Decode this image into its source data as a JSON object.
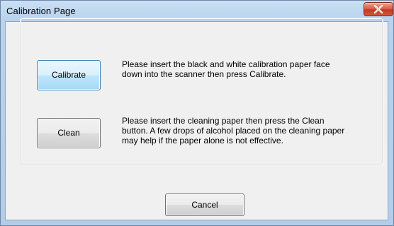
{
  "window": {
    "title": "Calibration Page"
  },
  "calibrate": {
    "button_label": "Calibrate",
    "description": "Please insert the black and white calibration paper face\ndown into the scanner then press Calibrate."
  },
  "clean": {
    "button_label": "Clean",
    "description": "Please insert the cleaning paper then press the Clean\nbutton. A few drops of alcohol placed on the cleaning paper\nmay help if the paper alone is not effective."
  },
  "footer": {
    "cancel_label": "Cancel"
  },
  "icons": {
    "close": "close-icon"
  },
  "colors": {
    "title_bar": "#b9d3ee",
    "close_button": "#c4391e",
    "client_background": "#f0f0f0",
    "focused_button": "#bee6fd"
  }
}
